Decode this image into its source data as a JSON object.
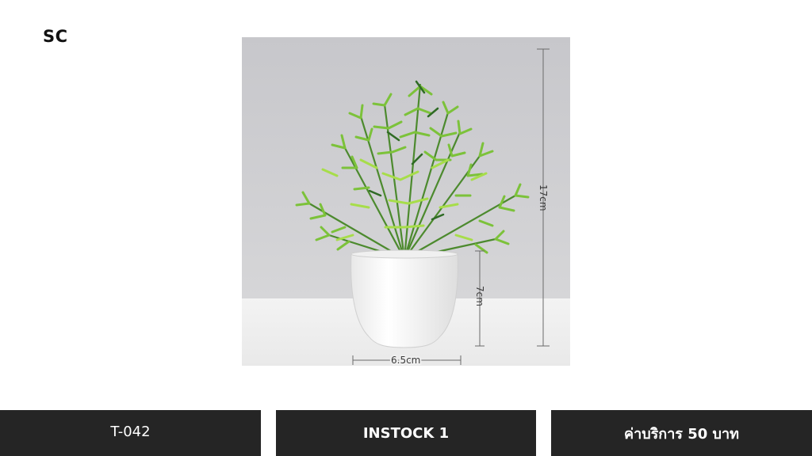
{
  "brand": {
    "logo_text": "SC"
  },
  "product": {
    "dimensions": {
      "height_total": "17cm",
      "pot_height": "7cm",
      "pot_width": "6.5cm"
    }
  },
  "footer": {
    "code": "T-042",
    "stock": "INSTOCK 1",
    "service_fee": "ค่าบริการ 50 บาท"
  },
  "colors": {
    "bar_background": "#252525",
    "leaf_light": "#8fd13a",
    "leaf_dark": "#3d7d2a",
    "pot": "#ffffff"
  }
}
